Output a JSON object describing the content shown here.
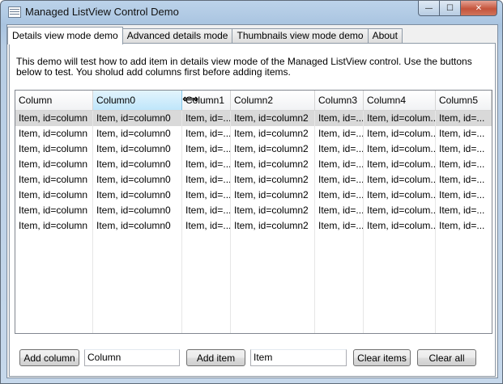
{
  "window": {
    "title": "Managed ListView Control Demo",
    "icon": "listview-app-icon",
    "min_glyph": "—",
    "max_glyph": "☐",
    "close_glyph": "✕"
  },
  "tabs": [
    {
      "label": "Details view mode demo",
      "active": true
    },
    {
      "label": "Advanced details mode",
      "active": false
    },
    {
      "label": "Thumbnails view mode demo",
      "active": false
    },
    {
      "label": "About",
      "active": false
    }
  ],
  "description": "This demo will test how to add item in details view mode of the Managed ListView control. Use the buttons below to test. You sholud add columns first before adding items.",
  "listview": {
    "columns": [
      "Column",
      "Column0",
      "Column1",
      "Column2",
      "Column3",
      "Column4",
      "Column5"
    ],
    "hovered_column": "Column0",
    "selected_row": 0,
    "rows": [
      [
        "Item, id=column",
        "Item, id=column0",
        "Item, id=...",
        "Item, id=column2",
        "Item, id=...",
        "Item, id=colum...",
        "Item, id=..."
      ],
      [
        "Item, id=column",
        "Item, id=column0",
        "Item, id=...",
        "Item, id=column2",
        "Item, id=...",
        "Item, id=colum...",
        "Item, id=..."
      ],
      [
        "Item, id=column",
        "Item, id=column0",
        "Item, id=...",
        "Item, id=column2",
        "Item, id=...",
        "Item, id=colum...",
        "Item, id=..."
      ],
      [
        "Item, id=column",
        "Item, id=column0",
        "Item, id=...",
        "Item, id=column2",
        "Item, id=...",
        "Item, id=colum...",
        "Item, id=..."
      ],
      [
        "Item, id=column",
        "Item, id=column0",
        "Item, id=...",
        "Item, id=column2",
        "Item, id=...",
        "Item, id=colum...",
        "Item, id=..."
      ],
      [
        "Item, id=column",
        "Item, id=column0",
        "Item, id=...",
        "Item, id=column2",
        "Item, id=...",
        "Item, id=colum...",
        "Item, id=..."
      ],
      [
        "Item, id=column",
        "Item, id=column0",
        "Item, id=...",
        "Item, id=column2",
        "Item, id=...",
        "Item, id=colum...",
        "Item, id=..."
      ],
      [
        "Item, id=column",
        "Item, id=column0",
        "Item, id=...",
        "Item, id=column2",
        "Item, id=...",
        "Item, id=colum...",
        "Item, id=..."
      ]
    ]
  },
  "controls": {
    "add_column_label": "Add column",
    "column_name_value": "Column",
    "add_item_label": "Add item",
    "item_text_value": "Item",
    "clear_items_label": "Clear items",
    "clear_all_label": "Clear all"
  },
  "colors": {
    "selected_row": "#d9d9d9",
    "header_hover": "#bfe6fb"
  }
}
